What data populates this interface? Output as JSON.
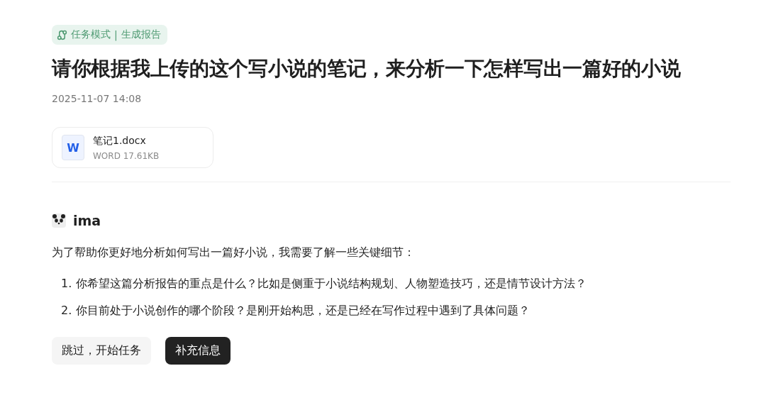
{
  "tag": {
    "mode": "任务模式",
    "separator": "|",
    "task": "生成报告"
  },
  "title": "请你根据我上传的这个写小说的笔记，来分析一下怎样写出一篇好的小说",
  "timestamp": "2025-11-07 14:08",
  "attachment": {
    "icon_letter": "W",
    "name": "笔记1.docx",
    "meta": "WORD 17.61KB"
  },
  "assistant": {
    "name": "ima"
  },
  "intro": "为了帮助你更好地分析如何写出一篇好小说，我需要了解一些关键细节：",
  "questions": [
    {
      "number": "1.",
      "text": "你希望这篇分析报告的重点是什么？比如是侧重于小说结构规划、人物塑造技巧，还是情节设计方法？"
    },
    {
      "number": "2.",
      "text": "你目前处于小说创作的哪个阶段？是刚开始构思，还是已经在写作过程中遇到了具体问题？"
    }
  ],
  "buttons": [
    {
      "label": "跳过，开始任务",
      "kind": "secondary"
    },
    {
      "label": "补充信息",
      "kind": "primary"
    }
  ]
}
